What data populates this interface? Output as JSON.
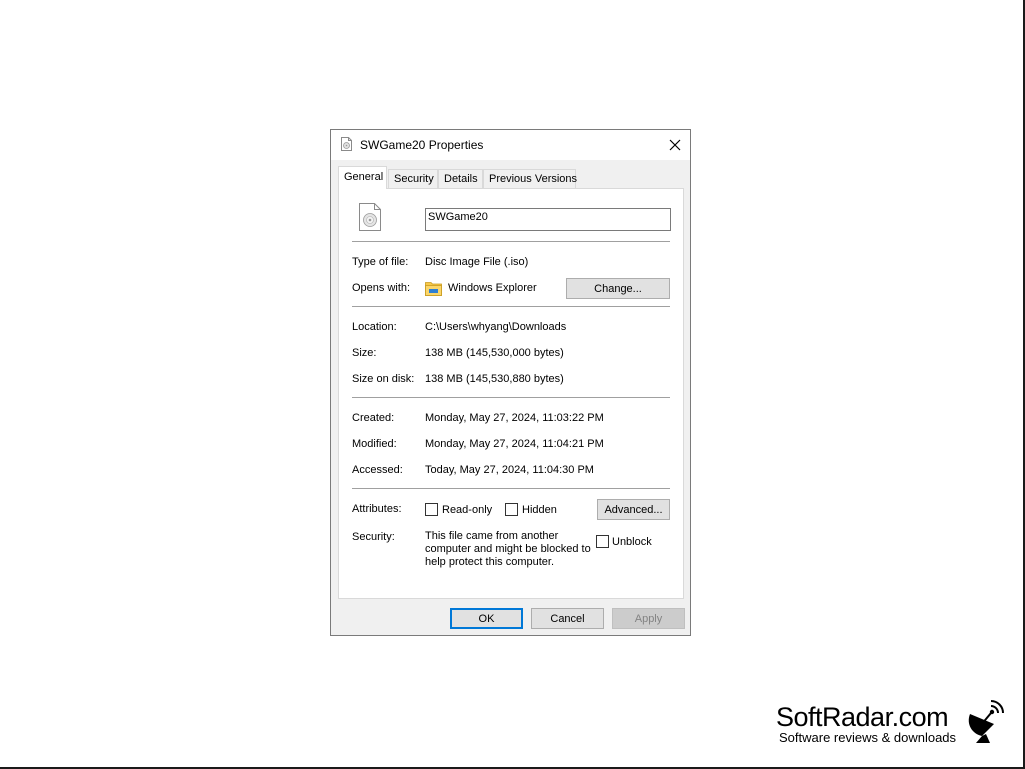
{
  "dialog": {
    "title": "SWGame20 Properties",
    "tabs": [
      {
        "label": "General",
        "active": true
      },
      {
        "label": "Security",
        "active": false
      },
      {
        "label": "Details",
        "active": false
      },
      {
        "label": "Previous Versions",
        "active": false
      }
    ],
    "file_name": "SWGame20",
    "type_of_file": {
      "label": "Type of file:",
      "value": "Disc Image File (.iso)"
    },
    "opens_with": {
      "label": "Opens with:",
      "value": "Windows Explorer",
      "change_button": "Change..."
    },
    "location": {
      "label": "Location:",
      "value": "C:\\Users\\whyang\\Downloads"
    },
    "size": {
      "label": "Size:",
      "value": "138 MB (145,530,000 bytes)"
    },
    "size_on_disk": {
      "label": "Size on disk:",
      "value": "138 MB (145,530,880 bytes)"
    },
    "created": {
      "label": "Created:",
      "value": "Monday, May 27, 2024, 11:03:22 PM"
    },
    "modified": {
      "label": "Modified:",
      "value": "Monday, May 27, 2024, 11:04:21 PM"
    },
    "accessed": {
      "label": "Accessed:",
      "value": "Today, May 27, 2024, 11:04:30 PM"
    },
    "attributes": {
      "label": "Attributes:",
      "read_only": {
        "label": "Read-only",
        "checked": false
      },
      "hidden": {
        "label": "Hidden",
        "checked": false
      },
      "advanced_button": "Advanced..."
    },
    "security": {
      "label": "Security:",
      "text": "This file came from another computer and might be blocked to help protect this computer.",
      "unblock": {
        "label": "Unblock",
        "checked": false
      }
    },
    "buttons": {
      "ok": "OK",
      "cancel": "Cancel",
      "apply": "Apply"
    }
  },
  "watermark": {
    "name": "SoftRadar.com",
    "tagline": "Software reviews & downloads"
  },
  "icons": {
    "title": "disc-file-icon",
    "close": "close-icon",
    "file": "disc-image-file-icon",
    "opens_with": "file-explorer-icon",
    "watermark": "satellite-dish-icon"
  },
  "colors": {
    "dialog_background": "#f0f0f0",
    "default_button_border": "#0078d7",
    "folder_yellow": "#f8c848"
  }
}
